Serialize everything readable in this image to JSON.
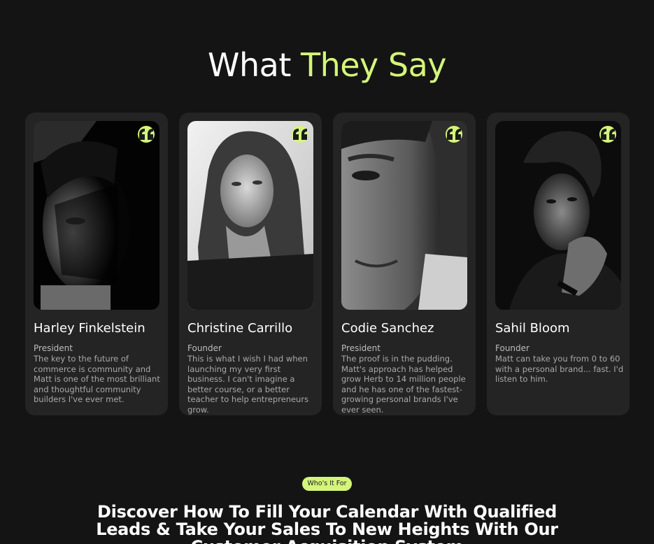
{
  "section": {
    "heading_white": "What ",
    "heading_accent": "They Say"
  },
  "testimonials": [
    {
      "name": "Harley Finkelstein",
      "role": "President",
      "quote": "The key to the future of commerce is community and Matt is one of the most brilliant and thoughtful community builders I've ever met."
    },
    {
      "name": "Christine Carrillo",
      "role": "Founder",
      "quote": "This is what I wish I had when launching my very first business. I can't imagine a better course, or a better teacher to help entrepreneurs grow."
    },
    {
      "name": "Codie Sanchez",
      "role": "President",
      "quote": "The proof is in the pudding. Matt's approach has helped grow Herb to 14 million people and he has one of the fastest-growing personal brands I've ever seen."
    },
    {
      "name": "Sahil Bloom",
      "role": "Founder",
      "quote": "Matt can take you from 0 to 60 with a personal brand... fast. I'd listen to him."
    }
  ],
  "next_section": {
    "tag": "Who's It For",
    "heading": "Discover How To Fill Your Calendar With Qualified Leads & Take Your Sales To New Heights With Our Customer Acquisition System"
  },
  "colors": {
    "background": "#141414",
    "card": "#242424",
    "accent": "#d4f57a"
  },
  "icons": {
    "quote": "quote-icon"
  }
}
